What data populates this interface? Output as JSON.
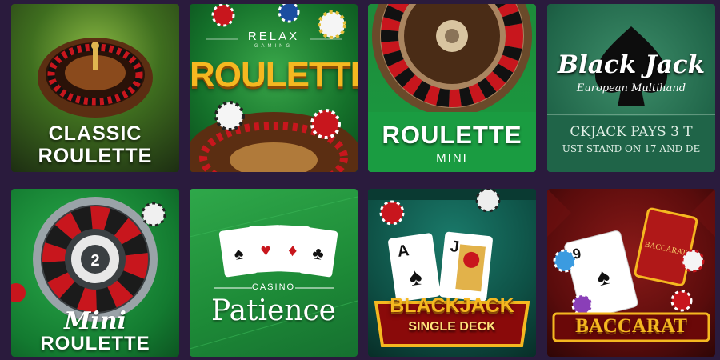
{
  "games": [
    {
      "id": "classic-roulette",
      "line1": "CLASSIC",
      "line2": "ROULETTE"
    },
    {
      "id": "relax-roulette",
      "brand": "RELAX",
      "brand_sub": "GAMING",
      "title": "ROULETTE"
    },
    {
      "id": "roulette-mini",
      "title": "ROULETTE",
      "subtitle": "MINI"
    },
    {
      "id": "blackjack-european",
      "title": "Black Jack",
      "subtitle": "European Multihand",
      "felt_line1": "CKJACK PAYS 3 T",
      "felt_line2": "UST STAND ON 17 AND DE"
    },
    {
      "id": "mini-roulette",
      "line1": "Mini",
      "line2": "ROULETTE"
    },
    {
      "id": "casino-patience",
      "kicker": "CASINO",
      "title": "Patience"
    },
    {
      "id": "blackjack-single-deck",
      "line1": "BLACKJACK",
      "line2": "SINGLE DECK"
    },
    {
      "id": "baccarat",
      "title": "BACCARAT",
      "card_label": "BACCARAT"
    }
  ],
  "colors": {
    "page_bg": "#2a1b3d",
    "gold": "#f5b820",
    "red": "#c8161d",
    "green": "#1a9c41"
  }
}
